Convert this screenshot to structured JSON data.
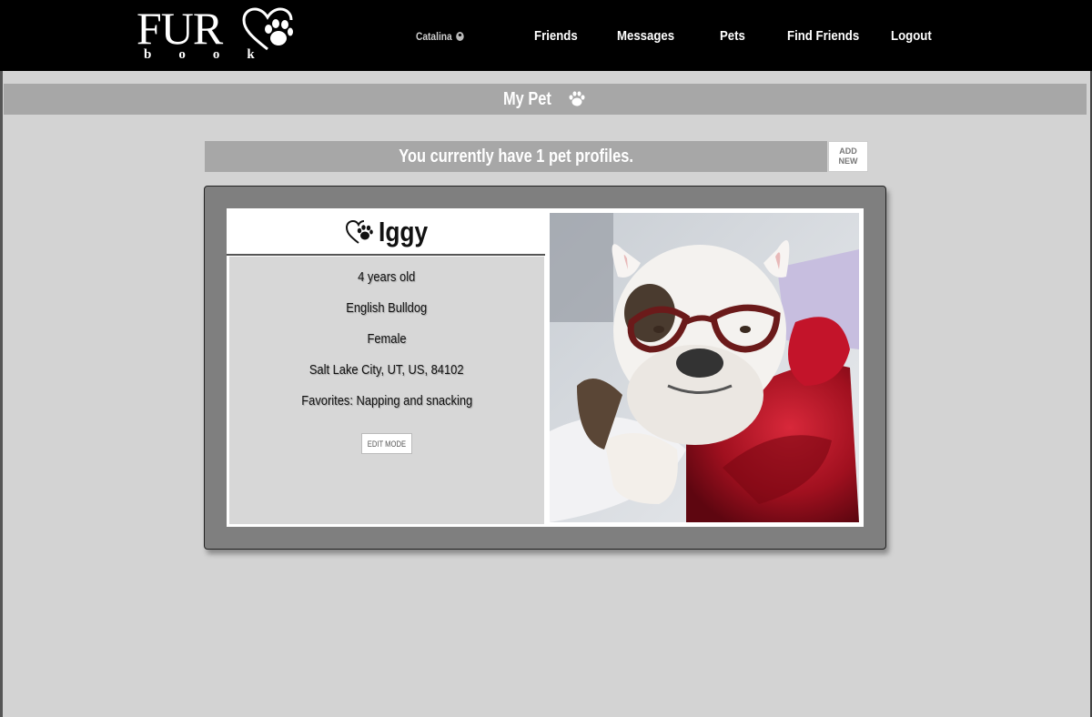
{
  "app": {
    "logo_word": "FUR",
    "logo_sub": "book"
  },
  "nav": {
    "user_name": "Catalina",
    "links": [
      {
        "label": "Friends"
      },
      {
        "label": "Messages"
      },
      {
        "label": "Pets"
      },
      {
        "label": "Find Friends"
      },
      {
        "label": "Logout"
      }
    ]
  },
  "header": {
    "title": "My Pet",
    "icon": "paw-icon"
  },
  "profiles": {
    "count_text": "You currently have 1 pet profiles.",
    "add_new_line1": "ADD",
    "add_new_line2": "NEW"
  },
  "pet": {
    "name": "Iggy",
    "name_icon": "heart-paw-icon",
    "age": "4 years old",
    "breed": "English Bulldog",
    "sex": "Female",
    "location": "Salt Lake City, UT, US, 84102",
    "favorites": "Favorites: Napping and snacking",
    "edit_label": "EDIT MODE",
    "photo": "bulldog-with-glasses-photo"
  },
  "colors": {
    "navbar": "#000000",
    "page_bg": "#d3d3d3",
    "header_bar": "#a7a7a7",
    "card_frame": "#7f7f7f"
  }
}
